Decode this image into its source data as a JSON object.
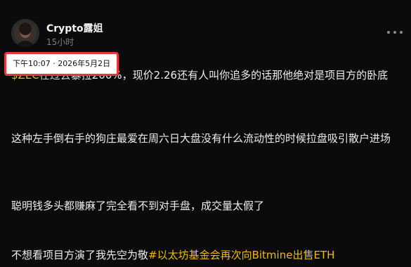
{
  "post": {
    "author_name": "Crypto露姐",
    "time_ago": "15小时",
    "timestamp_tooltip": "下午10:07 · 2026年5月2日",
    "paragraphs": {
      "p1_visible": "暴拉200%，现价2.26还有人叫你追多的话那他绝对是项目方的卧底",
      "p2": "这种左手倒右手的狗庄最爱在周六日大盘没有什么流动性的时候拉盘吸引散户进场",
      "p3": "聪明钱多头都赚麻了完全看不到对手盘，成交量太假了",
      "p4_text": "不想看项目方演了我先空为敬",
      "p4_hashtag": "#以太坊基金会再次向Bitmine出售ETH"
    }
  },
  "colors": {
    "background": "#0b0b0b",
    "text": "#ededed",
    "muted": "#7f7f7f",
    "accent": "#f0b90b",
    "tooltip_border": "#e03a3a"
  },
  "icons": {
    "avatar": "avatar-image",
    "more": "more-horizontal-icon"
  }
}
